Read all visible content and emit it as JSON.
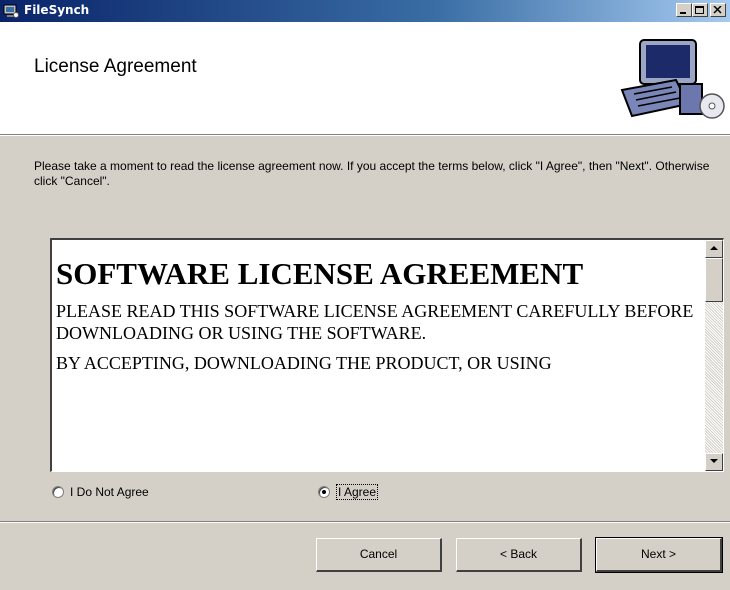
{
  "window": {
    "title": "FileSynch"
  },
  "header": {
    "title": "License Agreement"
  },
  "instructions": "Please take a moment to read the license agreement now. If you accept the terms below, click \"I Agree\", then \"Next\". Otherwise click \"Cancel\".",
  "license": {
    "heading": "SOFTWARE LICENSE AGREEMENT",
    "paragraph1": "PLEASE READ THIS SOFTWARE LICENSE AGREEMENT CAREFULLY BEFORE DOWNLOADING OR USING THE SOFTWARE.",
    "paragraph2": "BY ACCEPTING, DOWNLOADING THE PRODUCT, OR USING"
  },
  "radios": [
    {
      "label": "I Do Not Agree",
      "selected": false
    },
    {
      "label": "I Agree",
      "selected": true
    }
  ],
  "buttons": {
    "cancel": "Cancel",
    "back": "< Back",
    "next": "Next >"
  },
  "icons": {
    "app": "computer-icon",
    "header_art": "computer-disc-icon"
  },
  "colors": {
    "titlebar": "#0a246a",
    "face": "#d4d0c8"
  }
}
